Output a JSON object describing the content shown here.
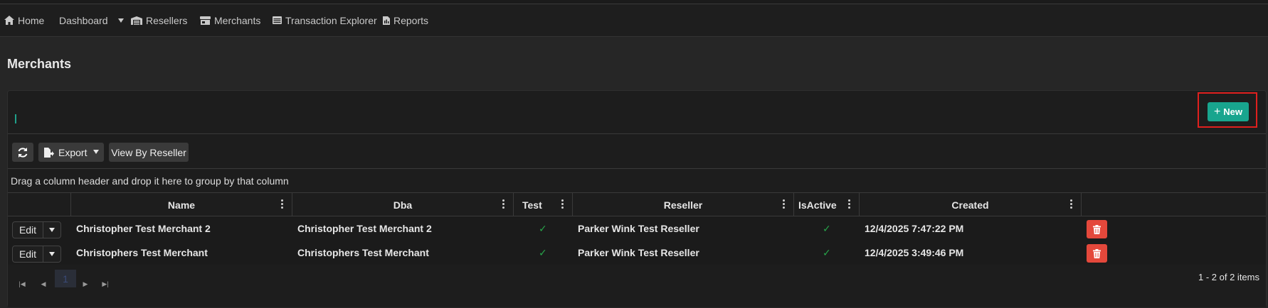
{
  "nav": {
    "home": "Home",
    "dashboard": "Dashboard",
    "resellers": "Resellers",
    "merchants": "Merchants",
    "transaction_explorer": "Transaction Explorer",
    "reports": "Reports"
  },
  "page": {
    "title": "Merchants"
  },
  "actions": {
    "new_label": "New"
  },
  "toolbar": {
    "export_label": "Export",
    "view_by_reseller_label": "View By Reseller"
  },
  "grid": {
    "group_hint": "Drag a column header and drop it here to group by that column",
    "columns": [
      "Name",
      "Dba",
      "Test",
      "Reseller",
      "IsActive",
      "Created"
    ],
    "rows": [
      {
        "edit": "Edit",
        "name": "Christopher Test Merchant 2",
        "dba": "Christopher Test Merchant 2",
        "test": true,
        "reseller": "Parker Wink Test Reseller",
        "is_active": true,
        "created": "12/4/2025 7:47:22 PM"
      },
      {
        "edit": "Edit",
        "name": "Christophers Test Merchant",
        "dba": "Christophers Test Merchant",
        "test": true,
        "reseller": "Parker Wink Test Reseller",
        "is_active": true,
        "created": "12/4/2025 3:49:46 PM"
      }
    ],
    "check_glyph": "✓"
  },
  "pager": {
    "current_page": "1",
    "info": "1 - 2 of 2 items"
  },
  "colors": {
    "accent": "#18a58e",
    "delete": "#e4483b",
    "check": "#27a64a",
    "highlight": "#e0201e"
  }
}
